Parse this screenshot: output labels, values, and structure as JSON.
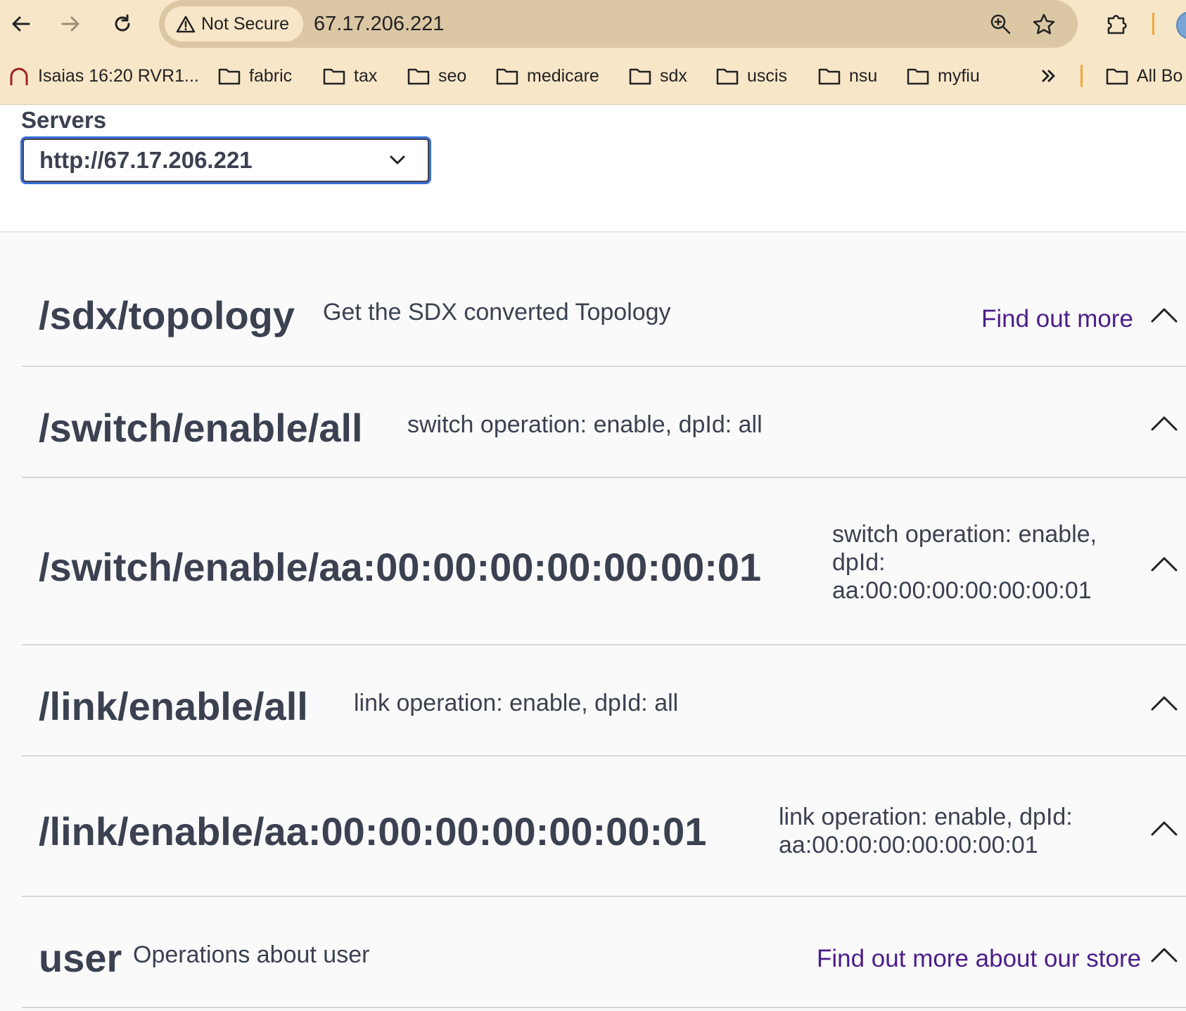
{
  "browser": {
    "security_label": "Not Secure",
    "url": "67.17.206.221",
    "icons": {
      "back": "arrow-left-icon",
      "forward": "arrow-right-icon",
      "reload": "reload-icon",
      "warning": "warning-triangle-icon",
      "zoom": "zoom-icon",
      "bookmark_star": "star-icon",
      "extensions": "puzzle-icon",
      "overflow": "double-chevron-right-icon"
    },
    "bookmarks": [
      {
        "label": "Isaias 16:20 RVR1...",
        "icon": "headphones-icon"
      },
      {
        "label": "fabric",
        "icon": "folder-icon"
      },
      {
        "label": "tax",
        "icon": "folder-icon"
      },
      {
        "label": "seo",
        "icon": "folder-icon"
      },
      {
        "label": "medicare",
        "icon": "folder-icon"
      },
      {
        "label": "sdx",
        "icon": "folder-icon"
      },
      {
        "label": "uscis",
        "icon": "folder-icon"
      },
      {
        "label": "nsu",
        "icon": "folder-icon"
      },
      {
        "label": "myfiu",
        "icon": "folder-icon"
      }
    ],
    "all_bookmarks_label": "All Bo",
    "colors": {
      "chrome": "#f8e6c8",
      "omnibox": "#dcc7a5",
      "divider": "#f0a83a"
    }
  },
  "servers": {
    "label": "Servers",
    "selected": "http://67.17.206.221"
  },
  "tags": [
    {
      "path": "/sdx/topology",
      "description": "Get the SDX converted Topology",
      "link": "Find out more"
    },
    {
      "path": "/switch/enable/all",
      "description": "switch operation: enable, dpId: all",
      "link": ""
    },
    {
      "path": "/switch/enable/aa:00:00:00:00:00:00:01",
      "description_lines": [
        "switch operation: enable,",
        "dpId:",
        "aa:00:00:00:00:00:00:01"
      ],
      "link": ""
    },
    {
      "path": "/link/enable/all",
      "description": "link operation: enable, dpId: all",
      "link": ""
    },
    {
      "path": "/link/enable/aa:00:00:00:00:00:00:01",
      "description_lines": [
        "link operation: enable, dpId:",
        "aa:00:00:00:00:00:00:01"
      ],
      "link": ""
    },
    {
      "path": "user",
      "description": "Operations about user",
      "link": "Find out more about our store"
    }
  ],
  "colors": {
    "link": "#4b1d89",
    "text": "#3b4151",
    "page_bg": "#fafafa",
    "focus": "#3a6fd8"
  }
}
